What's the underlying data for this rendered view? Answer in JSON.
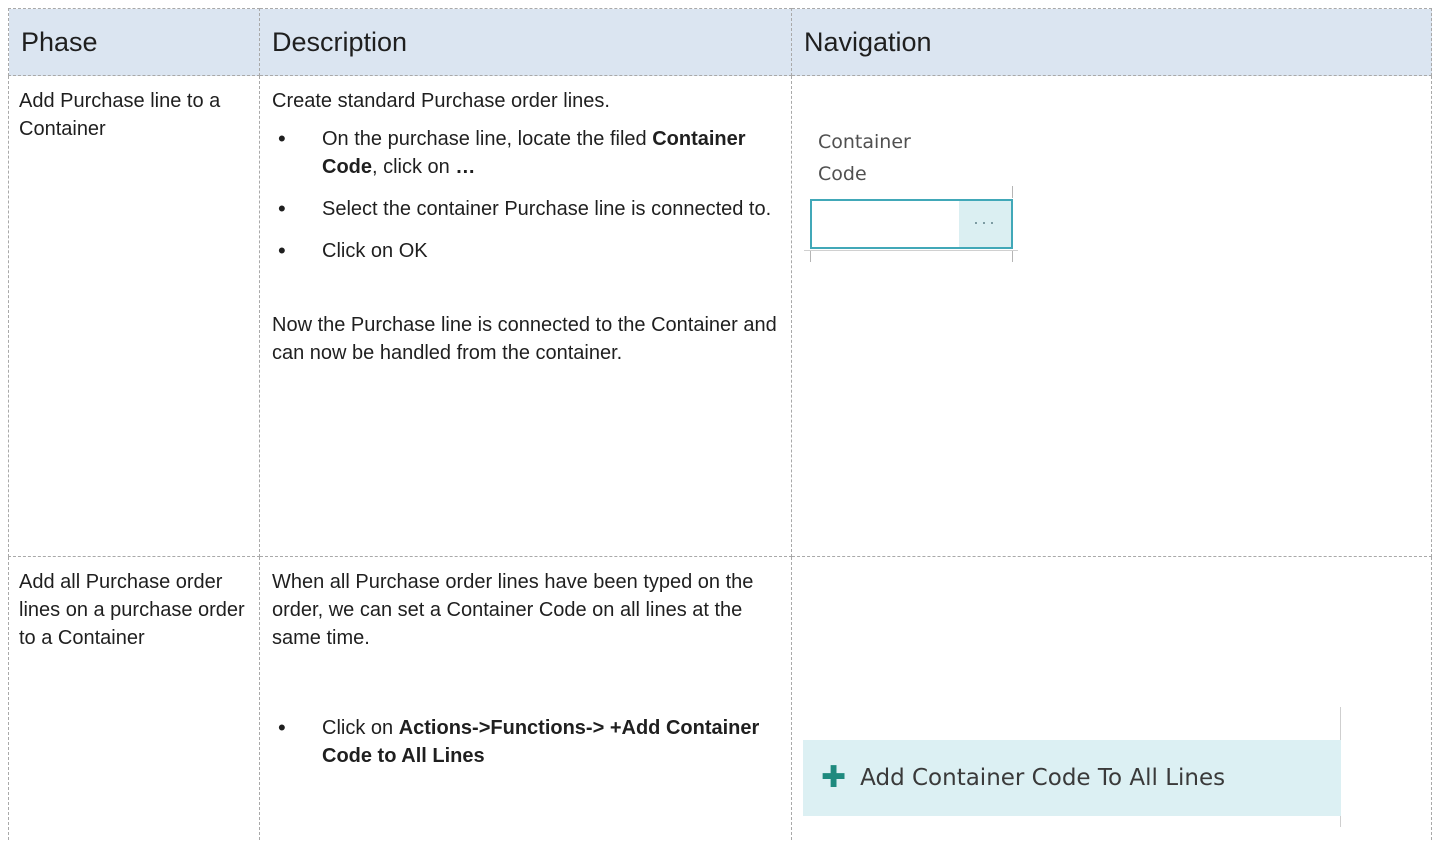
{
  "headers": [
    "Phase",
    "Description",
    "Navigation"
  ],
  "rows": [
    {
      "phase": "Add Purchase line to a Container",
      "intro": "Create standard Purchase order lines.",
      "bullets": [
        {
          "pre": "On the purchase line, locate the filed ",
          "bold": "Container Code",
          "mid": ", click on ",
          "bold2": "…"
        },
        {
          "text": "Select the container Purchase line is connected to."
        },
        {
          "text": "Click on OK"
        }
      ],
      "note": "Now the Purchase line is connected to the Container and can now be handled from the container.",
      "nav": {
        "field_label_1": "Container",
        "field_label_2": "Code",
        "field_value": "",
        "lookup_button": "···"
      }
    },
    {
      "phase": "Add all Purchase order lines on a purchase order to a Container",
      "intro": "When all Purchase order lines have been typed on the order, we can set a Container Code on all lines at the same time.",
      "bullet_pre": "Click on ",
      "bullet_bold": "Actions->Functions-> +Add Container Code to All Lines",
      "nav": {
        "action_label": "Add Container Code To All Lines",
        "action_icon": "plus-icon"
      }
    }
  ]
}
